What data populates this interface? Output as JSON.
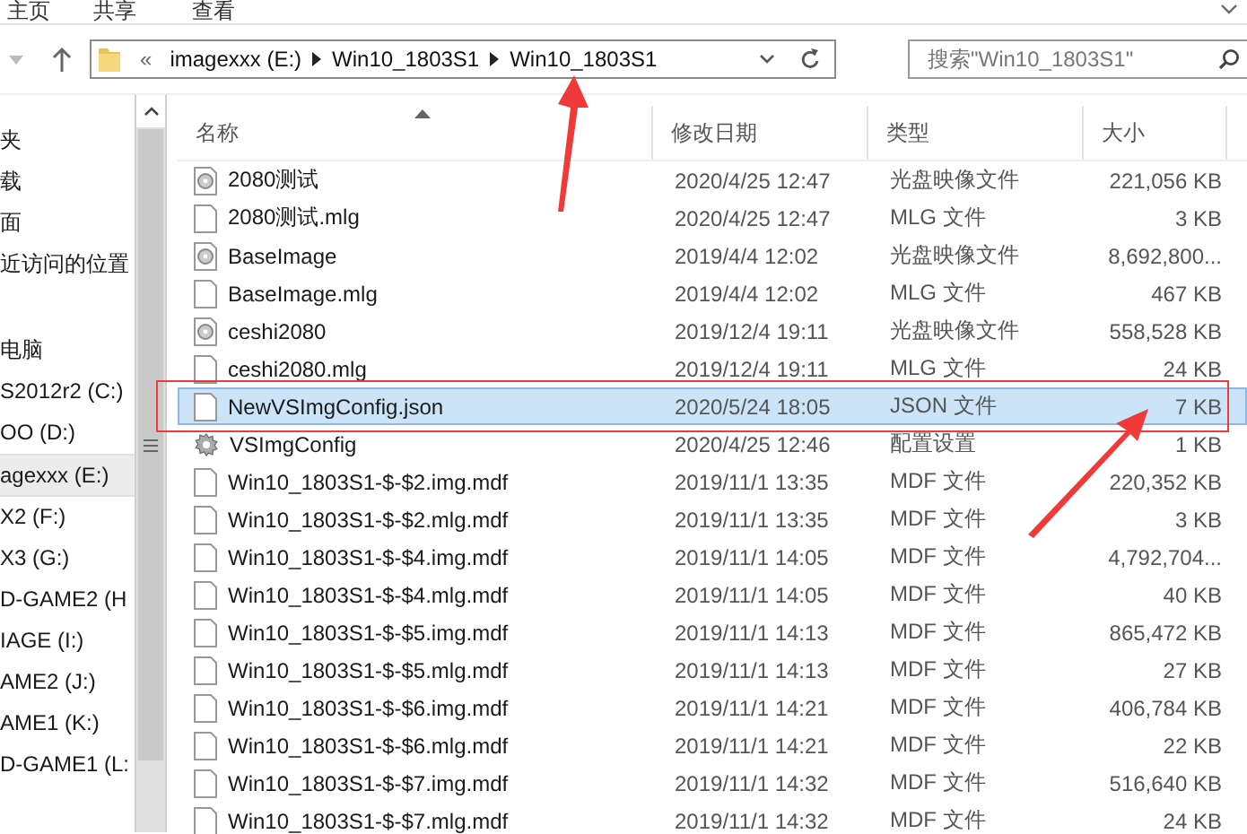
{
  "ribbon_tabs": [
    {
      "label": "主页"
    },
    {
      "label": "共享"
    },
    {
      "label": "查看"
    }
  ],
  "address_bar": {
    "overflow": "«",
    "crumbs": [
      "imagexxx (E:)",
      "Win10_1803S1",
      "Win10_1803S1"
    ]
  },
  "search": {
    "placeholder": "搜索\"Win10_1803S1\""
  },
  "sidebar": {
    "groups": [
      {
        "items": [
          {
            "label": "夹",
            "selected": false
          },
          {
            "label": "载",
            "selected": false
          },
          {
            "label": "面",
            "selected": false
          },
          {
            "label": "近访问的位置",
            "selected": false
          }
        ]
      },
      {
        "items": [
          {
            "label": "电脑",
            "selected": false
          },
          {
            "label": "S2012r2 (C:)",
            "selected": false
          },
          {
            "label": "OO (D:)",
            "selected": false
          },
          {
            "label": "agexxx (E:)",
            "selected": true
          },
          {
            "label": "X2 (F:)",
            "selected": false
          },
          {
            "label": "X3 (G:)",
            "selected": false
          },
          {
            "label": "D-GAME2 (H",
            "selected": false
          },
          {
            "label": "IAGE (I:)",
            "selected": false
          },
          {
            "label": "AME2 (J:)",
            "selected": false
          },
          {
            "label": "AME1 (K:)",
            "selected": false
          },
          {
            "label": "D-GAME1 (L:",
            "selected": false
          }
        ]
      }
    ]
  },
  "table": {
    "columns": [
      "名称",
      "修改日期",
      "类型",
      "大小"
    ],
    "rows": [
      {
        "kind": "disc",
        "name": "2080测试",
        "date": "2020/4/25 12:47",
        "type": "光盘映像文件",
        "size": "221,056 KB",
        "selected": false
      },
      {
        "kind": "file",
        "name": "2080测试.mlg",
        "date": "2020/4/25 12:47",
        "type": "MLG 文件",
        "size": "3 KB",
        "selected": false
      },
      {
        "kind": "disc",
        "name": "BaseImage",
        "date": "2019/4/4 12:02",
        "type": "光盘映像文件",
        "size": "8,692,800...",
        "selected": false
      },
      {
        "kind": "file",
        "name": "BaseImage.mlg",
        "date": "2019/4/4 12:02",
        "type": "MLG 文件",
        "size": "467 KB",
        "selected": false
      },
      {
        "kind": "disc",
        "name": "ceshi2080",
        "date": "2019/12/4 19:11",
        "type": "光盘映像文件",
        "size": "558,528 KB",
        "selected": false
      },
      {
        "kind": "file",
        "name": "ceshi2080.mlg",
        "date": "2019/12/4 19:11",
        "type": "MLG 文件",
        "size": "24 KB",
        "selected": false
      },
      {
        "kind": "file",
        "name": "NewVSImgConfig.json",
        "date": "2020/5/24 18:05",
        "type": "JSON 文件",
        "size": "7 KB",
        "selected": true
      },
      {
        "kind": "config",
        "name": "VSImgConfig",
        "date": "2020/4/25 12:46",
        "type": "配置设置",
        "size": "1 KB",
        "selected": false
      },
      {
        "kind": "file",
        "name": "Win10_1803S1-$-$2.img.mdf",
        "date": "2019/11/1 13:35",
        "type": "MDF 文件",
        "size": "220,352 KB",
        "selected": false
      },
      {
        "kind": "file",
        "name": "Win10_1803S1-$-$2.mlg.mdf",
        "date": "2019/11/1 13:35",
        "type": "MDF 文件",
        "size": "3 KB",
        "selected": false
      },
      {
        "kind": "file",
        "name": "Win10_1803S1-$-$4.img.mdf",
        "date": "2019/11/1 14:05",
        "type": "MDF 文件",
        "size": "4,792,704...",
        "selected": false
      },
      {
        "kind": "file",
        "name": "Win10_1803S1-$-$4.mlg.mdf",
        "date": "2019/11/1 14:05",
        "type": "MDF 文件",
        "size": "40 KB",
        "selected": false
      },
      {
        "kind": "file",
        "name": "Win10_1803S1-$-$5.img.mdf",
        "date": "2019/11/1 14:13",
        "type": "MDF 文件",
        "size": "865,472 KB",
        "selected": false
      },
      {
        "kind": "file",
        "name": "Win10_1803S1-$-$5.mlg.mdf",
        "date": "2019/11/1 14:13",
        "type": "MDF 文件",
        "size": "27 KB",
        "selected": false
      },
      {
        "kind": "file",
        "name": "Win10_1803S1-$-$6.img.mdf",
        "date": "2019/11/1 14:21",
        "type": "MDF 文件",
        "size": "406,784 KB",
        "selected": false
      },
      {
        "kind": "file",
        "name": "Win10_1803S1-$-$6.mlg.mdf",
        "date": "2019/11/1 14:21",
        "type": "MDF 文件",
        "size": "22 KB",
        "selected": false
      },
      {
        "kind": "file",
        "name": "Win10_1803S1-$-$7.img.mdf",
        "date": "2019/11/1 14:32",
        "type": "MDF 文件",
        "size": "516,640 KB",
        "selected": false
      },
      {
        "kind": "file",
        "name": "Win10_1803S1-$-$7.mlg.mdf",
        "date": "2019/11/1 14:32",
        "type": "MDF 文件",
        "size": "24 KB",
        "selected": false
      }
    ]
  }
}
